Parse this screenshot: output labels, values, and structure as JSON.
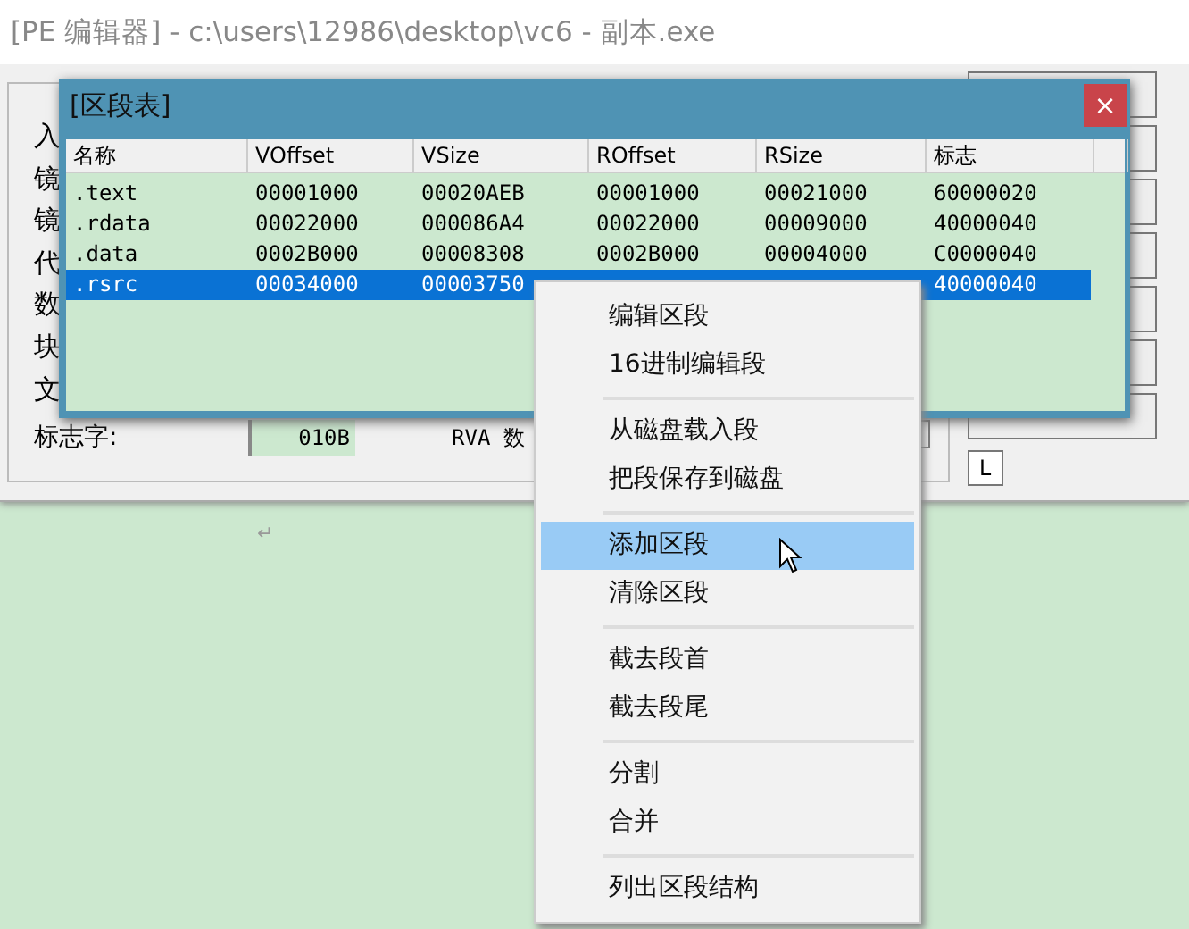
{
  "main_window": {
    "title": "[PE 编辑器] - c:\\users\\12986\\desktop\\vc6 - 副本.exe",
    "side_labels": [
      "入",
      "镜",
      "镜",
      "代",
      "数",
      "块",
      "文"
    ],
    "flag_label": "标志字:",
    "flag_value": "010B",
    "rva_label": "RVA 数",
    "l_button": "L"
  },
  "document": {
    "return_mark": "↵"
  },
  "section_dialog": {
    "title": "[区段表]",
    "close": "×",
    "columns": [
      "名称",
      "VOffset",
      "VSize",
      "ROffset",
      "RSize",
      "标志"
    ],
    "rows": [
      {
        "name": ".text",
        "voffset": "00001000",
        "vsize": "00020AEB",
        "roffset": "00001000",
        "rsize": "00021000",
        "flags": "60000020",
        "selected": false
      },
      {
        "name": ".rdata",
        "voffset": "00022000",
        "vsize": "000086A4",
        "roffset": "00022000",
        "rsize": "00009000",
        "flags": "40000040",
        "selected": false
      },
      {
        "name": ".data",
        "voffset": "0002B000",
        "vsize": "00008308",
        "roffset": "0002B000",
        "rsize": "00004000",
        "flags": "C0000040",
        "selected": false
      },
      {
        "name": ".rsrc",
        "voffset": "00034000",
        "vsize": "00003750",
        "flags": "40000040",
        "selected": true
      }
    ]
  },
  "context_menu": {
    "groups": [
      [
        {
          "label": "编辑区段",
          "selected": false
        },
        {
          "label": "16进制编辑段",
          "selected": false
        }
      ],
      [
        {
          "label": "从磁盘载入段",
          "selected": false
        },
        {
          "label": "把段保存到磁盘",
          "selected": false
        }
      ],
      [
        {
          "label": "添加区段",
          "selected": true
        },
        {
          "label": "清除区段",
          "selected": false
        }
      ],
      [
        {
          "label": "截去段首",
          "selected": false
        },
        {
          "label": "截去段尾",
          "selected": false
        }
      ],
      [
        {
          "label": "分割",
          "selected": false
        },
        {
          "label": "合并",
          "selected": false
        }
      ],
      [
        {
          "label": "列出区段结构",
          "selected": false
        }
      ]
    ]
  }
}
